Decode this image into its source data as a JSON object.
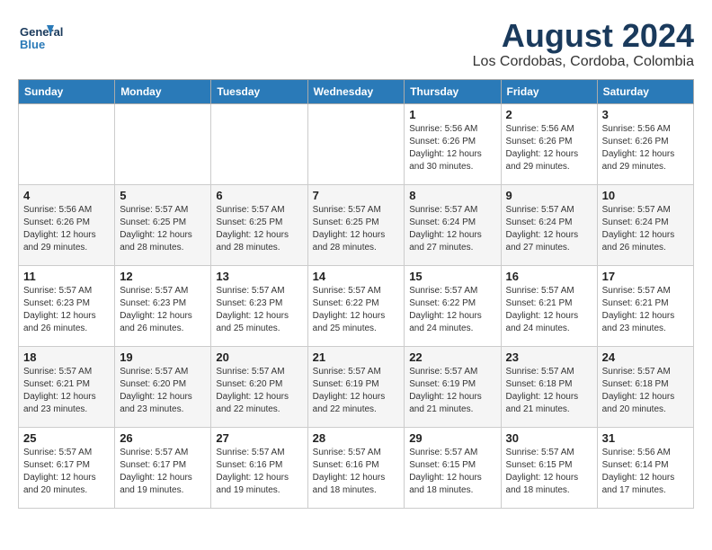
{
  "logo": {
    "line1": "General",
    "line2": "Blue"
  },
  "title": "August 2024",
  "subtitle": "Los Cordobas, Cordoba, Colombia",
  "days_of_week": [
    "Sunday",
    "Monday",
    "Tuesday",
    "Wednesday",
    "Thursday",
    "Friday",
    "Saturday"
  ],
  "weeks": [
    [
      {
        "day": "",
        "info": ""
      },
      {
        "day": "",
        "info": ""
      },
      {
        "day": "",
        "info": ""
      },
      {
        "day": "",
        "info": ""
      },
      {
        "day": "1",
        "info": "Sunrise: 5:56 AM\nSunset: 6:26 PM\nDaylight: 12 hours and 30 minutes."
      },
      {
        "day": "2",
        "info": "Sunrise: 5:56 AM\nSunset: 6:26 PM\nDaylight: 12 hours and 29 minutes."
      },
      {
        "day": "3",
        "info": "Sunrise: 5:56 AM\nSunset: 6:26 PM\nDaylight: 12 hours and 29 minutes."
      }
    ],
    [
      {
        "day": "4",
        "info": "Sunrise: 5:56 AM\nSunset: 6:26 PM\nDaylight: 12 hours and 29 minutes."
      },
      {
        "day": "5",
        "info": "Sunrise: 5:57 AM\nSunset: 6:25 PM\nDaylight: 12 hours and 28 minutes."
      },
      {
        "day": "6",
        "info": "Sunrise: 5:57 AM\nSunset: 6:25 PM\nDaylight: 12 hours and 28 minutes."
      },
      {
        "day": "7",
        "info": "Sunrise: 5:57 AM\nSunset: 6:25 PM\nDaylight: 12 hours and 28 minutes."
      },
      {
        "day": "8",
        "info": "Sunrise: 5:57 AM\nSunset: 6:24 PM\nDaylight: 12 hours and 27 minutes."
      },
      {
        "day": "9",
        "info": "Sunrise: 5:57 AM\nSunset: 6:24 PM\nDaylight: 12 hours and 27 minutes."
      },
      {
        "day": "10",
        "info": "Sunrise: 5:57 AM\nSunset: 6:24 PM\nDaylight: 12 hours and 26 minutes."
      }
    ],
    [
      {
        "day": "11",
        "info": "Sunrise: 5:57 AM\nSunset: 6:23 PM\nDaylight: 12 hours and 26 minutes."
      },
      {
        "day": "12",
        "info": "Sunrise: 5:57 AM\nSunset: 6:23 PM\nDaylight: 12 hours and 26 minutes."
      },
      {
        "day": "13",
        "info": "Sunrise: 5:57 AM\nSunset: 6:23 PM\nDaylight: 12 hours and 25 minutes."
      },
      {
        "day": "14",
        "info": "Sunrise: 5:57 AM\nSunset: 6:22 PM\nDaylight: 12 hours and 25 minutes."
      },
      {
        "day": "15",
        "info": "Sunrise: 5:57 AM\nSunset: 6:22 PM\nDaylight: 12 hours and 24 minutes."
      },
      {
        "day": "16",
        "info": "Sunrise: 5:57 AM\nSunset: 6:21 PM\nDaylight: 12 hours and 24 minutes."
      },
      {
        "day": "17",
        "info": "Sunrise: 5:57 AM\nSunset: 6:21 PM\nDaylight: 12 hours and 23 minutes."
      }
    ],
    [
      {
        "day": "18",
        "info": "Sunrise: 5:57 AM\nSunset: 6:21 PM\nDaylight: 12 hours and 23 minutes."
      },
      {
        "day": "19",
        "info": "Sunrise: 5:57 AM\nSunset: 6:20 PM\nDaylight: 12 hours and 23 minutes."
      },
      {
        "day": "20",
        "info": "Sunrise: 5:57 AM\nSunset: 6:20 PM\nDaylight: 12 hours and 22 minutes."
      },
      {
        "day": "21",
        "info": "Sunrise: 5:57 AM\nSunset: 6:19 PM\nDaylight: 12 hours and 22 minutes."
      },
      {
        "day": "22",
        "info": "Sunrise: 5:57 AM\nSunset: 6:19 PM\nDaylight: 12 hours and 21 minutes."
      },
      {
        "day": "23",
        "info": "Sunrise: 5:57 AM\nSunset: 6:18 PM\nDaylight: 12 hours and 21 minutes."
      },
      {
        "day": "24",
        "info": "Sunrise: 5:57 AM\nSunset: 6:18 PM\nDaylight: 12 hours and 20 minutes."
      }
    ],
    [
      {
        "day": "25",
        "info": "Sunrise: 5:57 AM\nSunset: 6:17 PM\nDaylight: 12 hours and 20 minutes."
      },
      {
        "day": "26",
        "info": "Sunrise: 5:57 AM\nSunset: 6:17 PM\nDaylight: 12 hours and 19 minutes."
      },
      {
        "day": "27",
        "info": "Sunrise: 5:57 AM\nSunset: 6:16 PM\nDaylight: 12 hours and 19 minutes."
      },
      {
        "day": "28",
        "info": "Sunrise: 5:57 AM\nSunset: 6:16 PM\nDaylight: 12 hours and 18 minutes."
      },
      {
        "day": "29",
        "info": "Sunrise: 5:57 AM\nSunset: 6:15 PM\nDaylight: 12 hours and 18 minutes."
      },
      {
        "day": "30",
        "info": "Sunrise: 5:57 AM\nSunset: 6:15 PM\nDaylight: 12 hours and 18 minutes."
      },
      {
        "day": "31",
        "info": "Sunrise: 5:56 AM\nSunset: 6:14 PM\nDaylight: 12 hours and 17 minutes."
      }
    ]
  ]
}
